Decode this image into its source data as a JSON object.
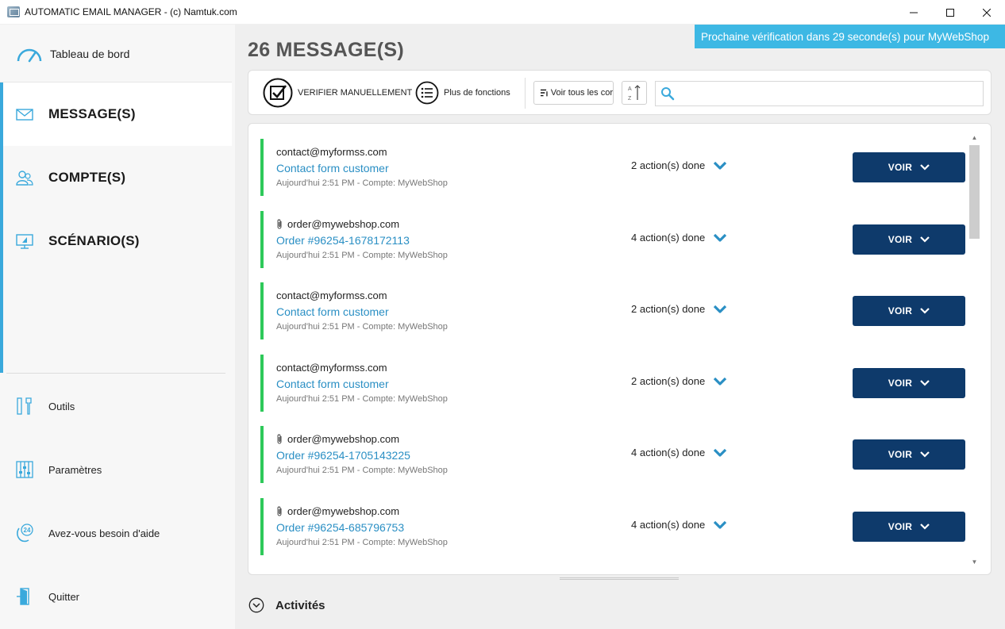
{
  "window": {
    "title": "AUTOMATIC EMAIL MANAGER - (c) Namtuk.com",
    "minimize": "—",
    "maximize": "☐",
    "close": "✕"
  },
  "sidebar": {
    "dashboard": {
      "label": "Tableau de bord",
      "icon": "speedometer-icon"
    },
    "nav": [
      {
        "label": "MESSAGE(S)",
        "icon": "envelope-icon",
        "active": true
      },
      {
        "label": "COMPTE(S)",
        "icon": "users-icon",
        "active": false
      },
      {
        "label": "SCÉNARIO(S)",
        "icon": "monitor-icon",
        "active": false
      }
    ],
    "tools": [
      {
        "label": "Outils",
        "icon": "tools-icon"
      },
      {
        "label": "Paramètres",
        "icon": "sliders-icon"
      },
      {
        "label": "Avez-vous besoin d'aide",
        "icon": "support-24-icon"
      },
      {
        "label": "Quitter",
        "icon": "exit-door-icon"
      }
    ],
    "accent_color": "#3aa9dc"
  },
  "main": {
    "title": "26 MESSAGE(S)",
    "notice": "Prochaine vérification dans 29 seconde(s) pour MyWebShop",
    "toolbar": {
      "verify_label": "VERIFIER MANUELLEMENT",
      "more_label": "Plus de fonctions",
      "view_all_label": "Voir tous les cor",
      "sort_icon": "sort-az-icon",
      "search_placeholder": "",
      "search_value": ""
    },
    "messages": [
      {
        "from": "contact@myformss.com",
        "attachment": false,
        "subject": "Contact form customer",
        "meta": "Aujourd'hui 2:51 PM - Compte: MyWebShop",
        "actions": "2 action(s) done",
        "button": "VOIR"
      },
      {
        "from": "order@mywebshop.com",
        "attachment": true,
        "subject": "Order #96254-1678172113",
        "meta": "Aujourd'hui 2:51 PM - Compte: MyWebShop",
        "actions": "4 action(s) done",
        "button": "VOIR"
      },
      {
        "from": "contact@myformss.com",
        "attachment": false,
        "subject": "Contact form customer",
        "meta": "Aujourd'hui 2:51 PM - Compte: MyWebShop",
        "actions": "2 action(s) done",
        "button": "VOIR"
      },
      {
        "from": "contact@myformss.com",
        "attachment": false,
        "subject": "Contact form customer",
        "meta": "Aujourd'hui 2:51 PM - Compte: MyWebShop",
        "actions": "2 action(s) done",
        "button": "VOIR"
      },
      {
        "from": "order@mywebshop.com",
        "attachment": true,
        "subject": "Order #96254-1705143225",
        "meta": "Aujourd'hui 2:51 PM - Compte: MyWebShop",
        "actions": "4 action(s) done",
        "button": "VOIR"
      },
      {
        "from": "order@mywebshop.com",
        "attachment": true,
        "subject": "Order #96254-685796753",
        "meta": "Aujourd'hui 2:51 PM - Compte: MyWebShop",
        "actions": "4 action(s) done",
        "button": "VOIR"
      }
    ],
    "activities_label": "Activités",
    "colors": {
      "status_bar": "#2ec95a",
      "button_bg": "#0e3a6b",
      "subject": "#2a8fc4",
      "notice_bg": "#3db8e4",
      "chevron": "#2a8fc4"
    }
  }
}
